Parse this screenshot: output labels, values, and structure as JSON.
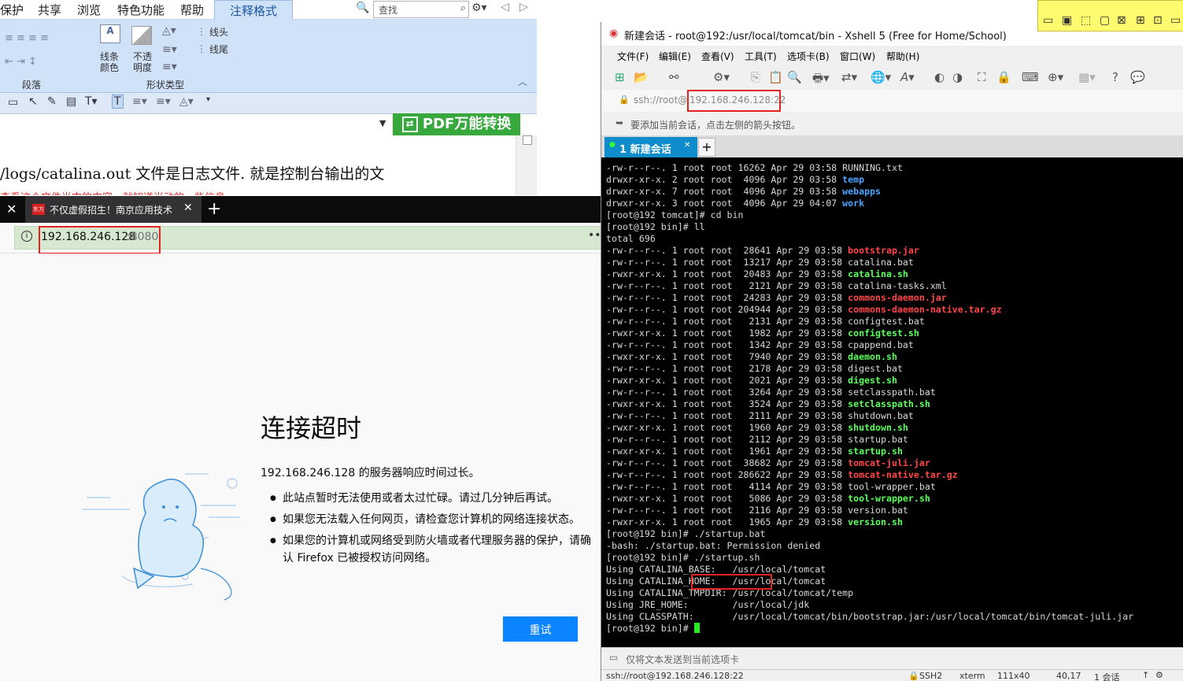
{
  "pdf_editor": {
    "menu": [
      "保护",
      "共享",
      "浏览",
      "特色功能",
      "帮助"
    ],
    "active_tab": "注释格式",
    "search_placeholder": "查找",
    "ribbon": {
      "line_color": "线条\n颜色",
      "opacity": "不透\n明度",
      "line_start": "线头",
      "line_end": "线尾",
      "group_paragraph": "段落",
      "group_shape": "形状类型"
    },
    "pdf_banner": "PDF万能转换",
    "doc_text": "/logs/catalina.out  文件是日志文件. 就是控制台输出的文",
    "doc_red": "查看这个文件当中的内容，就知道当动的一些信息"
  },
  "firefox": {
    "tab_title": "不仅虚假招生！南京应用技术",
    "url_host": "192.168.246.128",
    "url_port": ":8080",
    "error_title": "连接超时",
    "error_desc": "192.168.246.128 的服务器响应时间过长。",
    "bullets": [
      "此站点暂时无法使用或者太过忙碌。请过几分钟后再试。",
      "如果您无法载入任何网页，请检查您计算机的网络连接状态。",
      "如果您的计算机或网络受到防火墙或者代理服务器的保护，请确认 Firefox 已被授权访问网络。"
    ],
    "retry_label": "重试"
  },
  "xshell": {
    "title": "新建会话 - root@192:/usr/local/tomcat/bin - Xshell 5 (Free for Home/School)",
    "menu": [
      "文件(F)",
      "编辑(E)",
      "查看(V)",
      "工具(T)",
      "选项卡(B)",
      "窗口(W)",
      "帮助(H)"
    ],
    "address_prefix": "ssh://root@",
    "address_host": "192.168.246.128:22",
    "hint": "要添加当前会话，点击左侧的箭头按钮。",
    "session_tab": "1 新建会话",
    "send_bar": "仅将文本发送到当前选项卡",
    "status": {
      "address": "ssh://root@192.168.246.128:22",
      "protocol": "SSH2",
      "term": "xterm",
      "size": "111x40",
      "cursor": "40,17",
      "sessions": "1 会话"
    },
    "terminal_lines": [
      {
        "p": "-rw-r--r--. 1 root root 16262 Apr 29 03:58 ",
        "n": "RUNNING.txt",
        "c": ""
      },
      {
        "p": "drwxr-xr-x. 2 root root  4096 Apr 29 03:58 ",
        "n": "temp",
        "c": "blue"
      },
      {
        "p": "drwxr-xr-x. 7 root root  4096 Apr 29 03:58 ",
        "n": "webapps",
        "c": "blue"
      },
      {
        "p": "drwxr-xr-x. 3 root root  4096 Apr 29 04:07 ",
        "n": "work",
        "c": "blue"
      },
      {
        "p": "[root@192 tomcat]# cd bin",
        "n": "",
        "c": ""
      },
      {
        "p": "[root@192 bin]# ll",
        "n": "",
        "c": ""
      },
      {
        "p": "total 696",
        "n": "",
        "c": ""
      },
      {
        "p": "-rw-r--r--. 1 root root  28641 Apr 29 03:58 ",
        "n": "bootstrap.jar",
        "c": "red"
      },
      {
        "p": "-rw-r--r--. 1 root root  13217 Apr 29 03:58 ",
        "n": "catalina.bat",
        "c": ""
      },
      {
        "p": "-rwxr-xr-x. 1 root root  20483 Apr 29 03:58 ",
        "n": "catalina.sh",
        "c": "green"
      },
      {
        "p": "-rw-r--r--. 1 root root   2121 Apr 29 03:58 ",
        "n": "catalina-tasks.xml",
        "c": ""
      },
      {
        "p": "-rw-r--r--. 1 root root  24283 Apr 29 03:58 ",
        "n": "commons-daemon.jar",
        "c": "red"
      },
      {
        "p": "-rw-r--r--. 1 root root 204944 Apr 29 03:58 ",
        "n": "commons-daemon-native.tar.gz",
        "c": "red"
      },
      {
        "p": "-rw-r--r--. 1 root root   2131 Apr 29 03:58 ",
        "n": "configtest.bat",
        "c": ""
      },
      {
        "p": "-rwxr-xr-x. 1 root root   1982 Apr 29 03:58 ",
        "n": "configtest.sh",
        "c": "green"
      },
      {
        "p": "-rw-r--r--. 1 root root   1342 Apr 29 03:58 ",
        "n": "cpappend.bat",
        "c": ""
      },
      {
        "p": "-rwxr-xr-x. 1 root root   7940 Apr 29 03:58 ",
        "n": "daemon.sh",
        "c": "green"
      },
      {
        "p": "-rw-r--r--. 1 root root   2178 Apr 29 03:58 ",
        "n": "digest.bat",
        "c": ""
      },
      {
        "p": "-rwxr-xr-x. 1 root root   2021 Apr 29 03:58 ",
        "n": "digest.sh",
        "c": "green"
      },
      {
        "p": "-rw-r--r--. 1 root root   3264 Apr 29 03:58 ",
        "n": "setclasspath.bat",
        "c": ""
      },
      {
        "p": "-rwxr-xr-x. 1 root root   3524 Apr 29 03:58 ",
        "n": "setclasspath.sh",
        "c": "green"
      },
      {
        "p": "-rw-r--r--. 1 root root   2111 Apr 29 03:58 ",
        "n": "shutdown.bat",
        "c": ""
      },
      {
        "p": "-rwxr-xr-x. 1 root root   1960 Apr 29 03:58 ",
        "n": "shutdown.sh",
        "c": "green"
      },
      {
        "p": "-rw-r--r--. 1 root root   2112 Apr 29 03:58 ",
        "n": "startup.bat",
        "c": ""
      },
      {
        "p": "-rwxr-xr-x. 1 root root   1961 Apr 29 03:58 ",
        "n": "startup.sh",
        "c": "green"
      },
      {
        "p": "-rw-r--r--. 1 root root  38682 Apr 29 03:58 ",
        "n": "tomcat-juli.jar",
        "c": "red"
      },
      {
        "p": "-rw-r--r--. 1 root root 286622 Apr 29 03:58 ",
        "n": "tomcat-native.tar.gz",
        "c": "red"
      },
      {
        "p": "-rw-r--r--. 1 root root   4114 Apr 29 03:58 ",
        "n": "tool-wrapper.bat",
        "c": ""
      },
      {
        "p": "-rwxr-xr-x. 1 root root   5086 Apr 29 03:58 ",
        "n": "tool-wrapper.sh",
        "c": "green"
      },
      {
        "p": "-rw-r--r--. 1 root root   2116 Apr 29 03:58 ",
        "n": "version.bat",
        "c": ""
      },
      {
        "p": "-rwxr-xr-x. 1 root root   1965 Apr 29 03:58 ",
        "n": "version.sh",
        "c": "green"
      },
      {
        "p": "[root@192 bin]# ./startup.bat",
        "n": "",
        "c": ""
      },
      {
        "p": "-bash: ./startup.bat: Permission denied",
        "n": "",
        "c": ""
      },
      {
        "p": "[root@192 bin]# ./startup.sh",
        "n": "",
        "c": ""
      },
      {
        "p": "Using CATALINA_BASE:   /usr/local/tomcat",
        "n": "",
        "c": ""
      },
      {
        "p": "Using CATALINA_HOME:   /usr/local/tomcat",
        "n": "",
        "c": ""
      },
      {
        "p": "Using CATALINA_TMPDIR: /usr/local/tomcat/temp",
        "n": "",
        "c": ""
      },
      {
        "p": "Using JRE_HOME:        /usr/local/jdk",
        "n": "",
        "c": ""
      },
      {
        "p": "Using CLASSPATH:       /usr/local/tomcat/bin/bootstrap.jar:/usr/local/tomcat/bin/tomcat-juli.jar",
        "n": "",
        "c": ""
      },
      {
        "p": "[root@192 bin]# ",
        "n": "",
        "c": "",
        "cursor": true
      }
    ]
  },
  "colors": {
    "ribbon_bg": "#cfe2f8",
    "pdf_banner_green": "#37a83c",
    "firefox_url_bg": "#d7e8d1",
    "firefox_retry": "#0a84ff",
    "xshell_tab": "#0e8ccc",
    "highlight_red": "#e32222",
    "term_blue": "#4aa3ff",
    "term_red": "#ff4646",
    "term_green": "#5bff5b"
  }
}
